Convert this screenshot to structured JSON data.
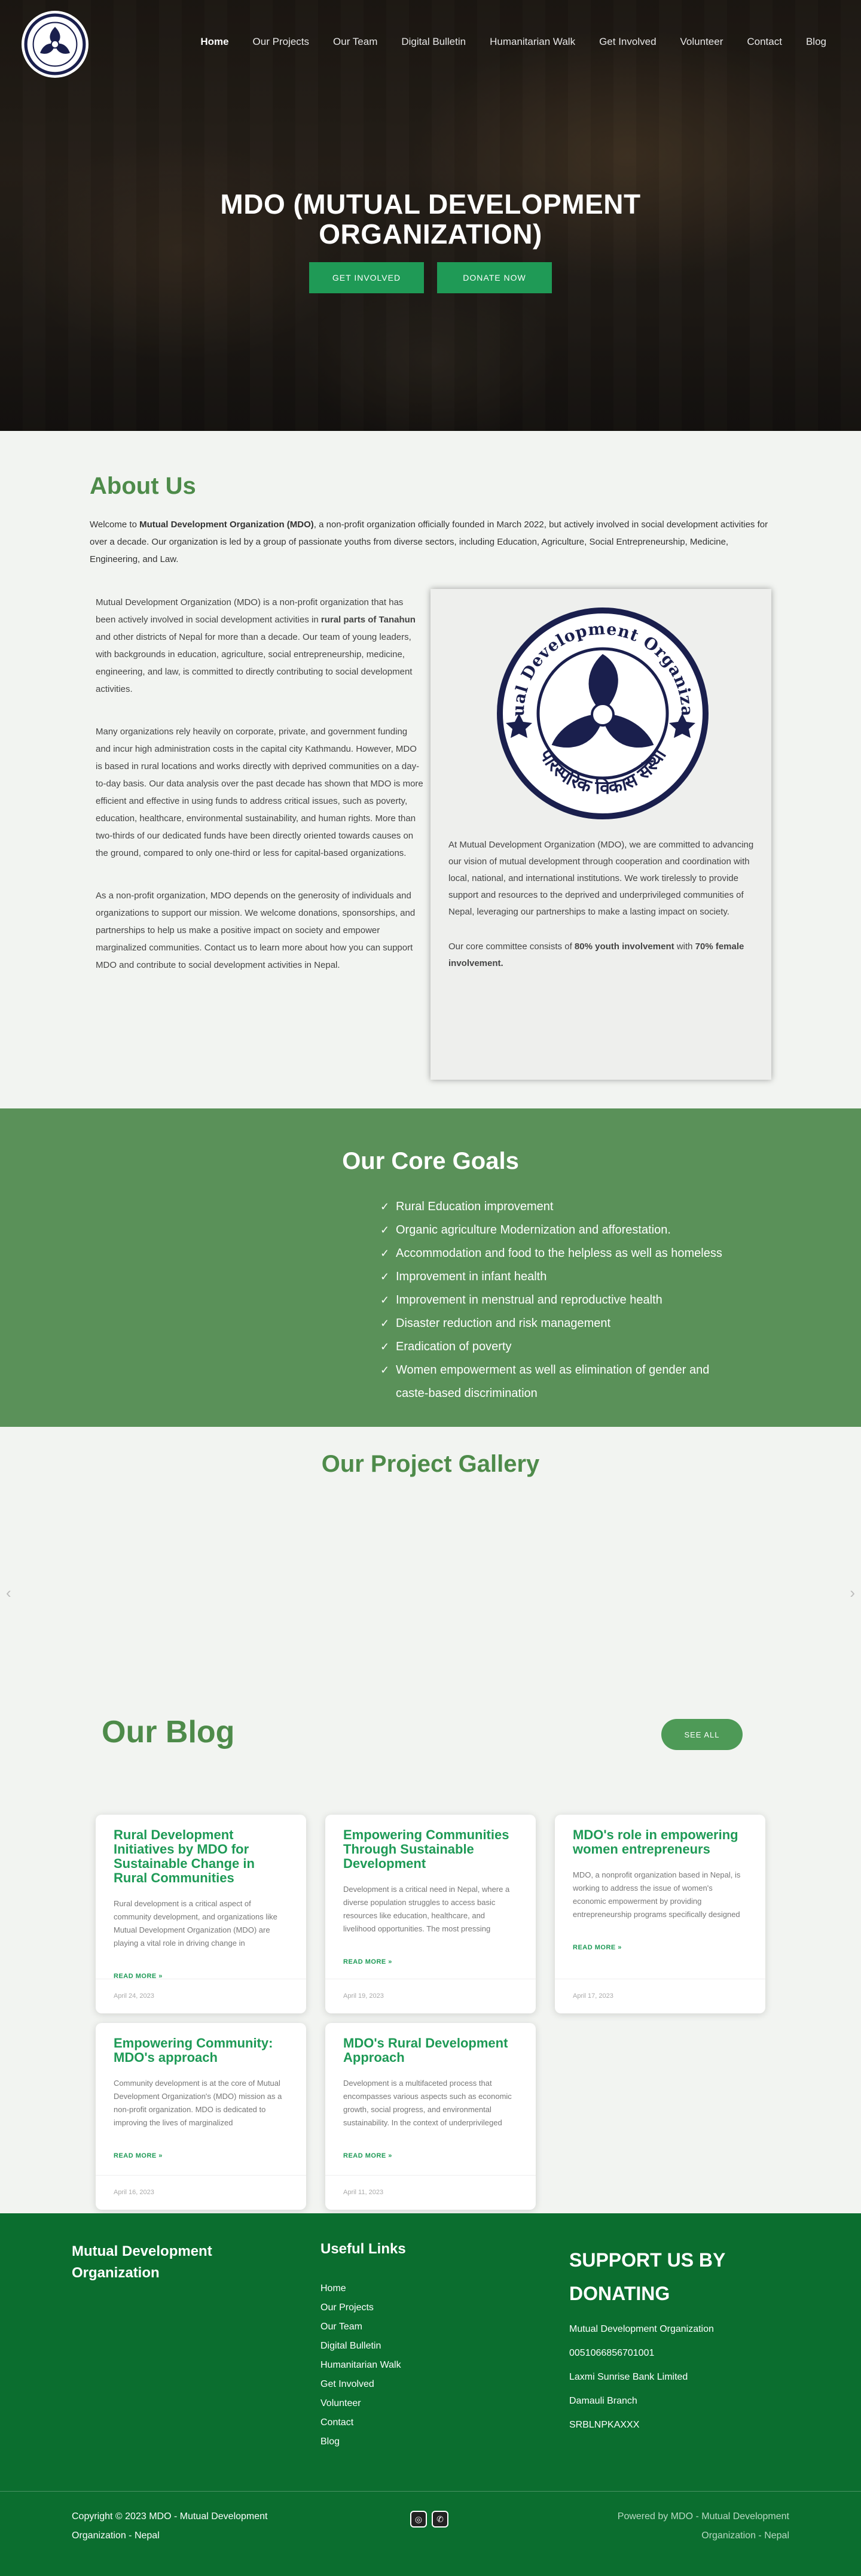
{
  "nav": {
    "items": [
      "Home",
      "Our Projects",
      "Our Team",
      "Digital Bulletin",
      "Humanitarian Walk",
      "Get Involved",
      "Volunteer",
      "Contact",
      "Blog"
    ],
    "active": "Home"
  },
  "hero": {
    "title_line1": "MDO (MUTUAL DEVELOPMENT",
    "title_line2": "ORGANIZATION)",
    "btn_involved": "GET INVOLVED",
    "btn_donate": "DONATE NOW"
  },
  "about": {
    "heading": "About Us",
    "intro_pre": "Welcome to ",
    "intro_bold": "Mutual Development Organization (MDO)",
    "intro_post": ", a non-profit organization officially founded in March 2022, but actively involved in social development activities for over a decade. Our organization is led by a group of passionate youths from diverse sectors, including Education, Agriculture, Social Entrepreneurship, Medicine, Engineering, and Law.",
    "p1_pre": "Mutual Development Organization (MDO) is a non-profit organization that has been actively involved in social development activities in ",
    "p1_bold": "rural parts of Tanahun",
    "p1_post": " and other districts of Nepal for more than a decade. Our team of young leaders, with backgrounds in education, agriculture, social entrepreneurship, medicine, engineering, and law, is committed to directly contributing to social development activities.",
    "p2": "Many organizations rely heavily on corporate, private, and government funding and incur high administration costs in the capital city Kathmandu. However, MDO is based in rural locations and works directly with deprived communities on a day-to-day basis. Our data analysis over the past decade has shown that MDO is more efficient and effective in using funds to address critical issues, such as poverty, education, healthcare, environmental sustainability, and human rights. More than two-thirds of our dedicated funds have been directly oriented towards causes on the ground, compared to only one-third or less for capital-based organizations.",
    "p3": "As a non-profit organization, MDO depends on the generosity of individuals and organizations to support our mission. We welcome donations, sponsorships, and partnerships to help us make a positive impact on society and empower marginalized communities. Contact us to learn more about how you can support MDO and contribute to social development activities in Nepal.",
    "card_p1": "At Mutual Development Organization (MDO), we are committed to advancing our vision of mutual development through cooperation and coordination with local, national, and international institutions. We work tirelessly to provide support and resources to the deprived and underprivileged communities of Nepal, leveraging our partnerships to make a lasting impact on society.",
    "card_p2_pre": "Our core committee consists of ",
    "card_p2_bold1": "80% youth involvement",
    "card_p2_mid": " with ",
    "card_p2_bold2": "70% female involvement."
  },
  "logo": {
    "ring_text": "Mutual Development Organization",
    "bottom_text": "पारस्परिक विकास संस्था"
  },
  "goals": {
    "heading": "Our Core Goals",
    "items": [
      "Rural Education improvement",
      "Organic agriculture Modernization and afforestation.",
      "Accommodation and food to the helpless as well as homeless",
      "Improvement in infant health",
      "Improvement in menstrual and reproductive health",
      "Disaster reduction and risk management",
      "Eradication of poverty",
      "Women empowerment as well as elimination of gender and caste-based discrimination"
    ]
  },
  "gallery": {
    "heading": "Our Project Gallery"
  },
  "blog": {
    "heading": "Our Blog",
    "see_all": "SEE ALL",
    "read_more": "READ MORE »",
    "posts": [
      {
        "title": "Rural Development Initiatives by MDO for Sustainable Change in Rural Communities",
        "excerpt": "Rural development is a critical aspect of community development, and organizations like Mutual Development Organization (MDO) are playing a vital role in driving change in",
        "date": "April 24, 2023"
      },
      {
        "title": "Empowering Communities Through Sustainable Development",
        "excerpt": "Development is a critical need in Nepal, where a diverse population struggles to access basic resources like education, healthcare, and livelihood opportunities. The most pressing",
        "date": "April 19, 2023"
      },
      {
        "title": "MDO's role in empowering women entrepreneurs",
        "excerpt": "MDO, a nonprofit organization based in Nepal, is working to address the issue of women's economic empowerment by providing entrepreneurship programs specifically designed to empower",
        "date": "April 17, 2023"
      },
      {
        "title": "Empowering Community: MDO's approach",
        "excerpt": "Community development is at the core of Mutual Development Organization's (MDO) mission as a non-profit organization. MDO is dedicated to improving the lives of marginalized",
        "date": "April 16, 2023"
      },
      {
        "title": "MDO's Rural Development Approach",
        "excerpt": "Development is a multifaceted process that encompasses various aspects such as economic growth, social progress, and environmental sustainability. In the context of underprivileged communities in",
        "date": "April 11, 2023"
      }
    ]
  },
  "footer": {
    "org_name": "Mutual Development Organization",
    "links_heading": "Useful Links",
    "links": [
      "Home",
      "Our Projects",
      "Our Team",
      "Digital Bulletin",
      "Humanitarian Walk",
      "Get Involved",
      "Volunteer",
      "Contact",
      "Blog"
    ],
    "donate_heading": "SUPPORT US BY DONATING",
    "donate_lines": [
      "Mutual Development Organization",
      "0051066856701001",
      "Laxmi Sunrise Bank Limited",
      "Damauli Branch",
      "SRBLNPKAXXX"
    ],
    "copyright": "Copyright © 2023 MDO - Mutual Development Organization - Nepal",
    "powered": "Powered by MDO - Mutual Development Organization - Nepal"
  },
  "colors": {
    "brand_green": "#4e8b4a",
    "button_green": "#1f9a56",
    "goals_bg": "#5a9159",
    "footer_bg": "#0b6e2f",
    "logo_navy": "#1a1f4d"
  }
}
